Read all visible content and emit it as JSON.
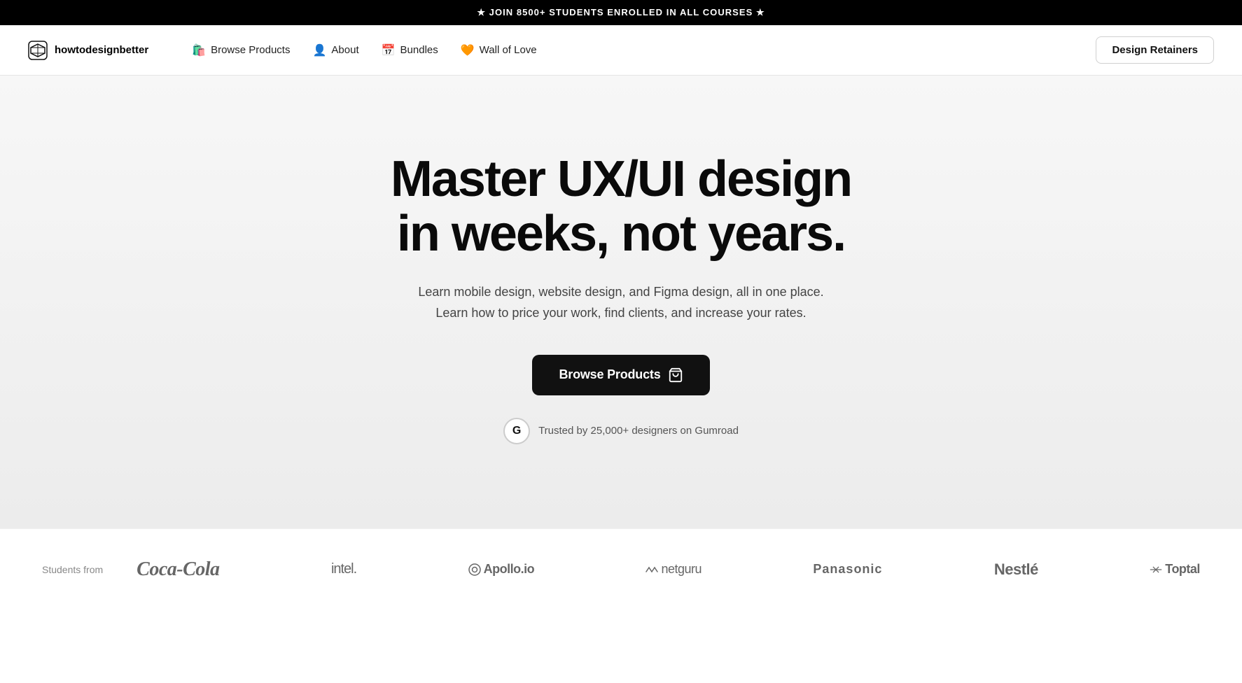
{
  "banner": {
    "text": "★ JOIN 8500+ STUDENTS ENROLLED IN ALL COURSES ★"
  },
  "navbar": {
    "logo_text": "howtodesignbetter",
    "links": [
      {
        "label": "Browse Products",
        "icon": "🛍️"
      },
      {
        "label": "About",
        "icon": "👤"
      },
      {
        "label": "Bundles",
        "icon": "📅"
      },
      {
        "label": "Wall of Love",
        "icon": "🧡"
      }
    ],
    "cta_label": "Design Retainers"
  },
  "hero": {
    "title": "Master UX/UI design in weeks, not years.",
    "subtitle_line1": "Learn mobile design, website design, and Figma design, all in one place.",
    "subtitle_line2": "Learn how to price your work, find clients, and increase your rates.",
    "cta_label": "Browse Products",
    "trust_text": "Trusted by 25,000+ designers on Gumroad",
    "gumroad_letter": "G"
  },
  "brands": {
    "label": "Students from",
    "logos": [
      {
        "name": "Coca-Cola",
        "display": "Coca-Cola",
        "style": "coca-cola"
      },
      {
        "name": "Intel",
        "display": "intel.",
        "style": "intel"
      },
      {
        "name": "Apollo.io",
        "display": "◉ Apollo.io",
        "style": "apollo"
      },
      {
        "name": "Netguru",
        "display": "⌒ netguru",
        "style": "netguru"
      },
      {
        "name": "Panasonic",
        "display": "Panasonic",
        "style": "panasonic"
      },
      {
        "name": "Nestlé",
        "display": "Nestlé",
        "style": "nestle"
      },
      {
        "name": "Toptal",
        "display": "⟺ Toptal",
        "style": "toptal"
      }
    ]
  }
}
